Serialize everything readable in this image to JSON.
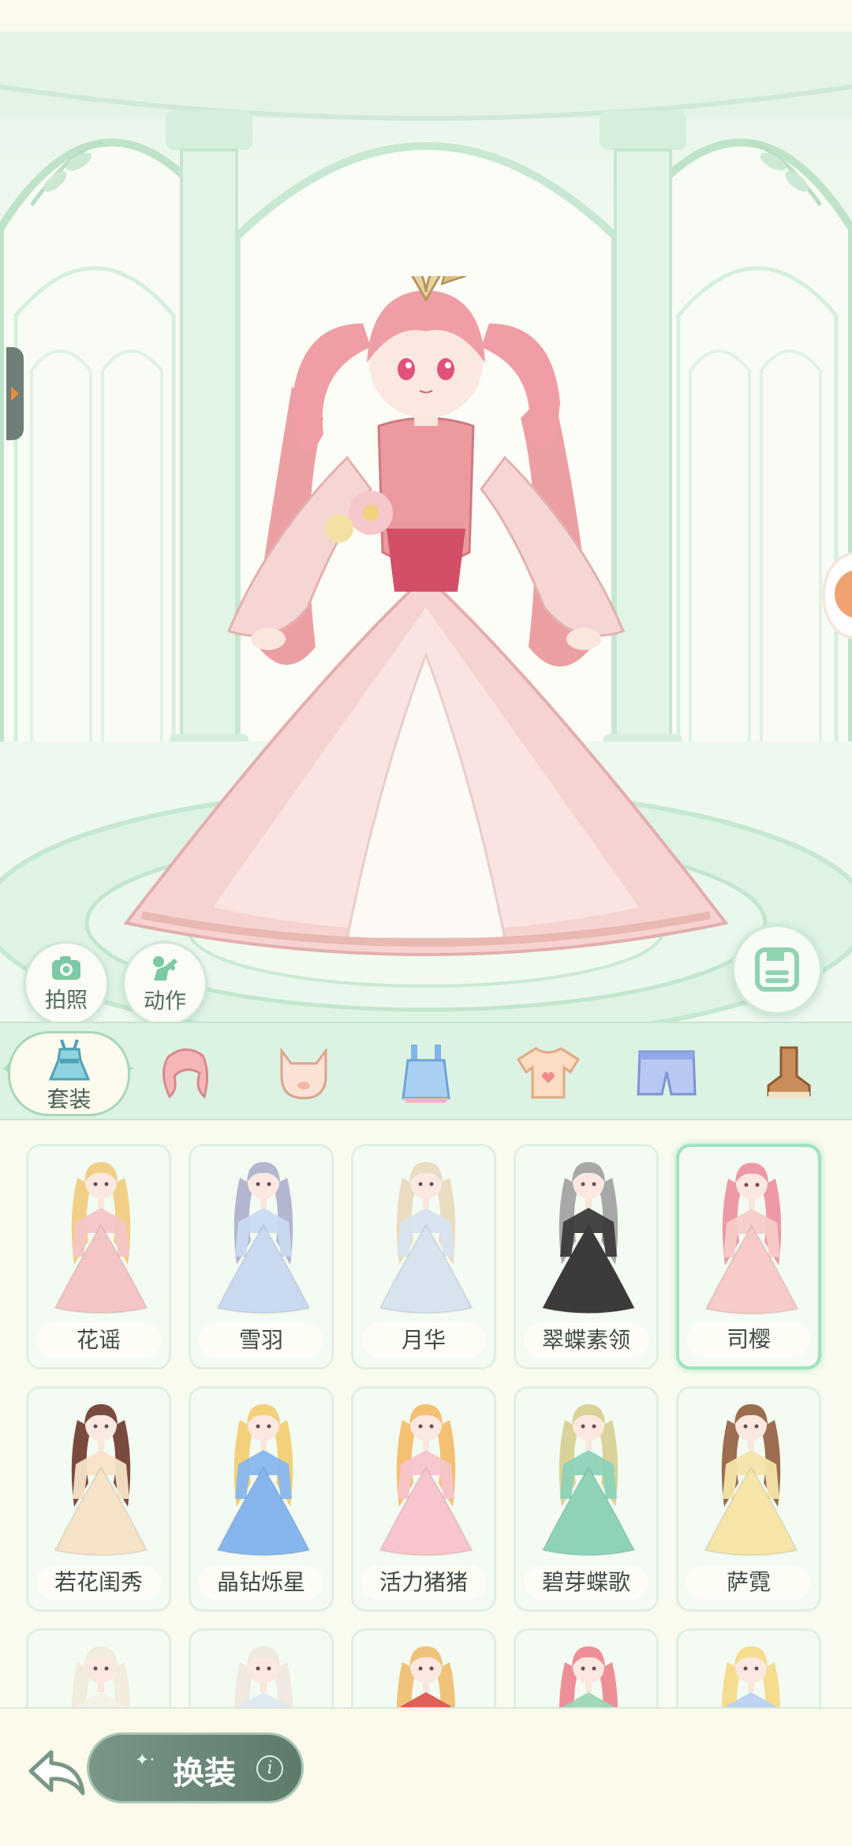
{
  "stage": {
    "photo_label": "拍照",
    "action_label": "动作",
    "photo_icon": "camera-icon",
    "action_icon": "pose-icon",
    "save_icon": "save-icon"
  },
  "categories": {
    "active_label": "套装",
    "items": [
      "outfit-set-icon",
      "hair-icon",
      "face-icon",
      "dress-icon",
      "top-icon",
      "shorts-icon",
      "shoes-icon"
    ]
  },
  "outfits": [
    {
      "name": "花谣",
      "hair": "#f1cf86",
      "dress": "#f5c5c6",
      "selected": false
    },
    {
      "name": "雪羽",
      "hair": "#b3b6cf",
      "dress": "#c9daf0",
      "selected": false
    },
    {
      "name": "月华",
      "hair": "#eadcc0",
      "dress": "#d7e3ef",
      "selected": false
    },
    {
      "name": "翠蝶素领",
      "hair": "#a8a8a8",
      "dress": "#3c3a3a",
      "selected": false
    },
    {
      "name": "司樱",
      "hair": "#ee9aa6",
      "dress": "#f6cbc8",
      "selected": true
    },
    {
      "name": "若花闺秀",
      "hair": "#7b4a3f",
      "dress": "#f7e3c8",
      "selected": false
    },
    {
      "name": "晶钻烁星",
      "hair": "#f3d07a",
      "dress": "#87b6ee",
      "selected": false
    },
    {
      "name": "活力猪猪",
      "hair": "#f4c173",
      "dress": "#f7c5cb",
      "selected": false
    },
    {
      "name": "碧芽蝶歌",
      "hair": "#d9d39a",
      "dress": "#8ed2b8",
      "selected": false
    },
    {
      "name": "萨霓",
      "hair": "#9c6d4e",
      "dress": "#f5e5a9",
      "selected": false
    },
    {
      "name": "",
      "hair": "#f1ecdc",
      "dress": "#f4f0e6",
      "selected": false
    },
    {
      "name": "",
      "hair": "#efe9e0",
      "dress": "#dde8f2",
      "selected": false
    },
    {
      "name": "",
      "hair": "#f0c27a",
      "dress": "#d95a4b",
      "selected": false
    },
    {
      "name": "",
      "hair": "#ee8f97",
      "dress": "#9ad7b4",
      "selected": false
    },
    {
      "name": "",
      "hair": "#f6dc8e",
      "dress": "#b9d1f0",
      "selected": false
    }
  ],
  "bottom": {
    "change_label": "换装",
    "info_label": "i",
    "back_icon": "back-arrow-icon"
  },
  "colors": {
    "accent_green": "#9fe3c0",
    "panel_green": "#dcf2e2",
    "button_dark": "#5d7b6b"
  }
}
